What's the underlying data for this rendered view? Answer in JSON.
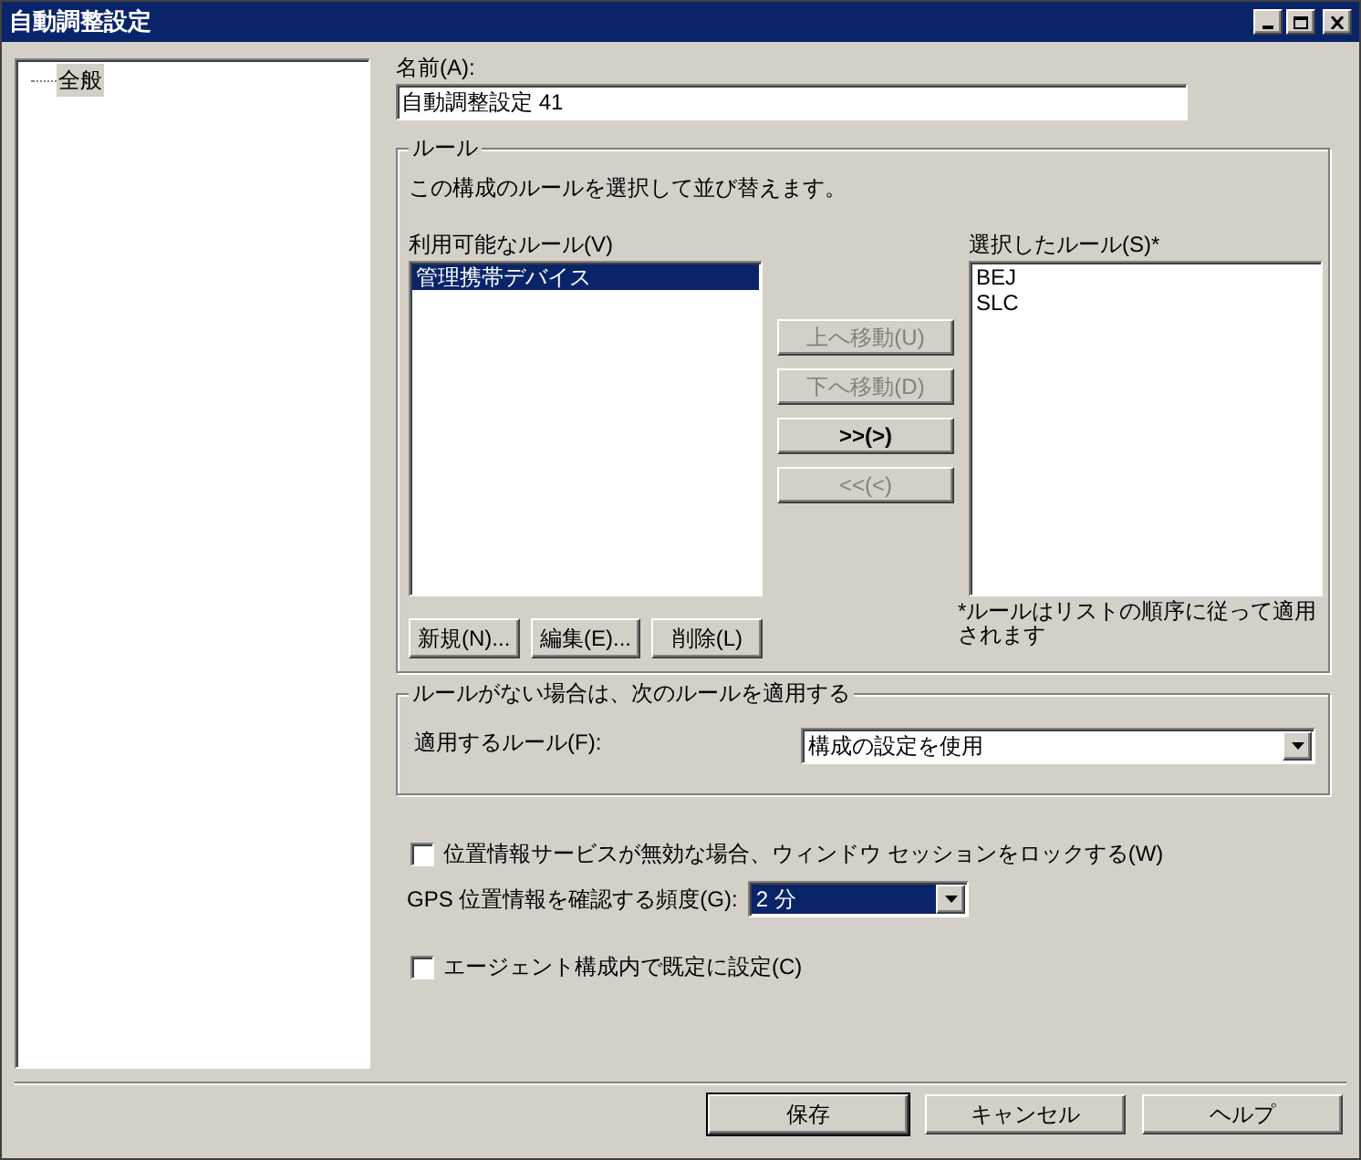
{
  "window": {
    "title": "自動調整設定"
  },
  "tree": {
    "items": [
      {
        "label": "全般",
        "selected": true
      }
    ]
  },
  "name_field": {
    "label": "名前(A):",
    "value": "自動調整設定 41"
  },
  "rules_group": {
    "title": "ルール",
    "description": "この構成のルールを選択して並び替えます。",
    "available": {
      "label": "利用可能なルール(V)",
      "items": [
        {
          "label": "管理携帯デバイス",
          "selected": true
        }
      ]
    },
    "move_buttons": [
      {
        "label": "上へ移動(U)",
        "disabled": true
      },
      {
        "label": "下へ移動(D)",
        "disabled": true
      },
      {
        "label": ">>(>)",
        "disabled": false
      },
      {
        "label": "<<(<)",
        "disabled": true
      }
    ],
    "selected_rules": {
      "label": "選択したルール(S)*",
      "items": [
        {
          "label": "BEJ",
          "selected": false
        },
        {
          "label": "SLC",
          "selected": false
        }
      ]
    },
    "footnote": "*ルールはリストの順序に従って適用されます",
    "buttons": [
      "新規(N)...",
      "編集(E)...",
      "削除(L)"
    ]
  },
  "fallback_group": {
    "title": "ルールがない場合は、次のルールを適用する",
    "label": "適用するルール(F):",
    "value": "構成の設定を使用"
  },
  "lock_checkbox": {
    "label": "位置情報サービスが無効な場合、ウィンドウ セッションをロックする(W)",
    "checked": false
  },
  "gps_frequency": {
    "label": "GPS 位置情報を確認する頻度(G):",
    "value": "2 分"
  },
  "default_checkbox": {
    "label": "エージェント構成内で既定に設定(C)",
    "checked": false
  },
  "footer_buttons": [
    {
      "label": "保存",
      "default": true
    },
    {
      "label": "キャンセル",
      "default": false
    },
    {
      "label": "ヘルプ",
      "default": false
    }
  ]
}
